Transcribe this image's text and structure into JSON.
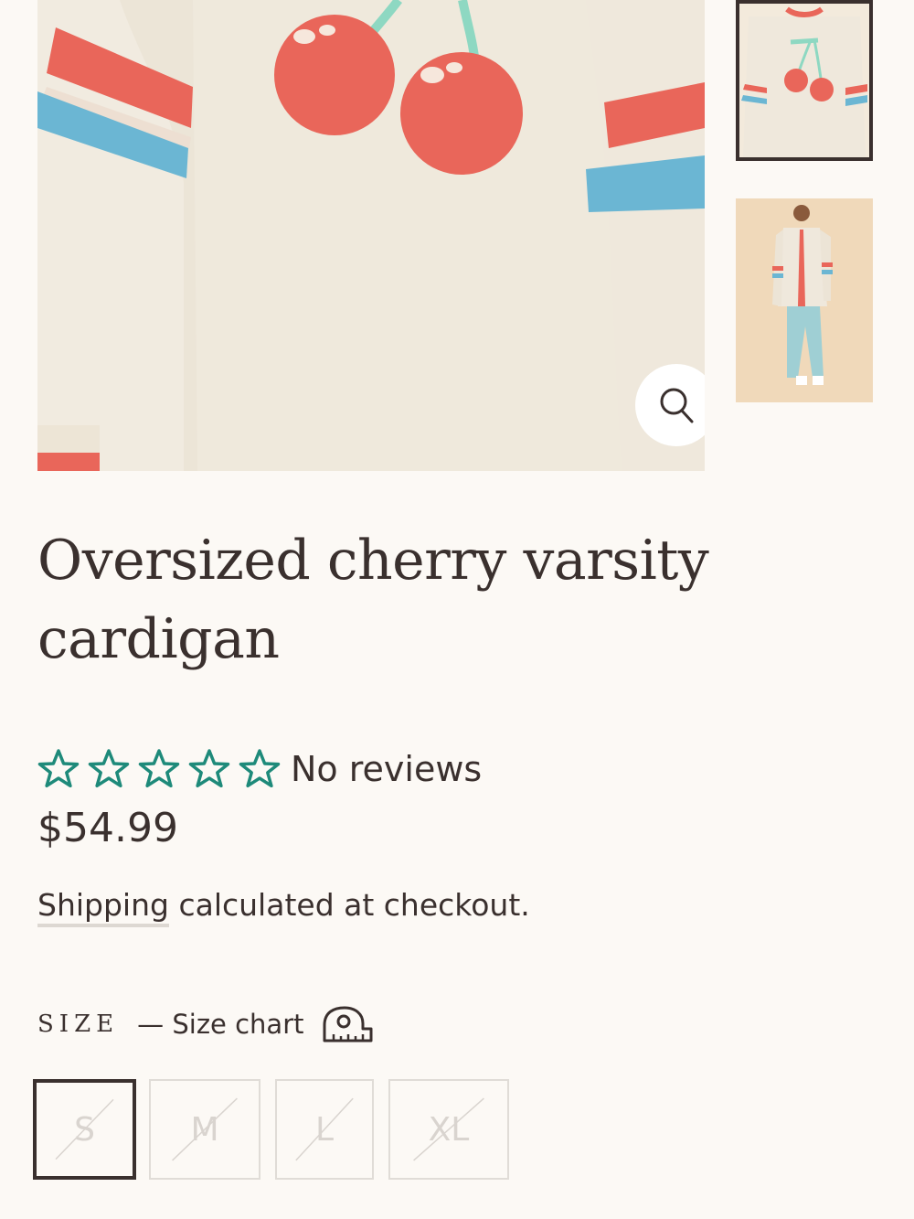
{
  "product": {
    "title": "Oversized cherry varsity cardigan",
    "rating": {
      "stars": 0,
      "max_stars": 5,
      "text": "No reviews",
      "star_color": "#1e8a7a"
    },
    "price": "$54.99",
    "shipping": {
      "link_text": "Shipping",
      "rest_text": "calculated at checkout."
    },
    "size": {
      "label": "SIZE",
      "chart_text": "— Size chart",
      "options": [
        {
          "label": "S",
          "selected": true,
          "available": false
        },
        {
          "label": "M",
          "selected": false,
          "available": false
        },
        {
          "label": "L",
          "selected": false,
          "available": false
        },
        {
          "label": "XL",
          "selected": false,
          "available": false
        }
      ]
    }
  },
  "gallery": {
    "zoom_icon": "magnifier-icon",
    "thumbnails": [
      "back-view",
      "full-body-front-view"
    ]
  },
  "colors": {
    "text": "#3a302e",
    "background": "#fcf9f5",
    "cherry": "#e9665a",
    "stem": "#8ed8c2",
    "stripe_blue": "#6bb6d3"
  }
}
